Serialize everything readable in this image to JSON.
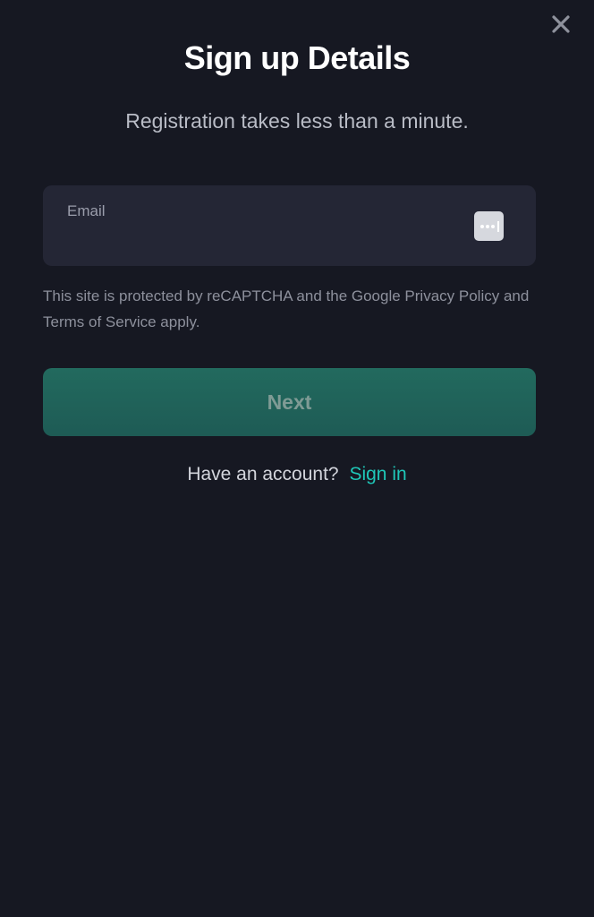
{
  "modal": {
    "title": "Sign up Details",
    "subtitle": "Registration takes less than a minute.",
    "close_icon": "close-icon"
  },
  "form": {
    "email_label": "Email",
    "email_value": "",
    "password_manager_icon": "password-manager-icon",
    "recaptcha_notice": "This site is protected by reCAPTCHA and the Google Privacy Policy and Terms of Service apply.",
    "next_label": "Next"
  },
  "footer": {
    "prompt": "Have an account?",
    "signin_label": "Sign in"
  },
  "colors": {
    "background": "#161822",
    "input_background": "#242635",
    "accent": "#1fc7b8",
    "button": "#226a5e"
  }
}
